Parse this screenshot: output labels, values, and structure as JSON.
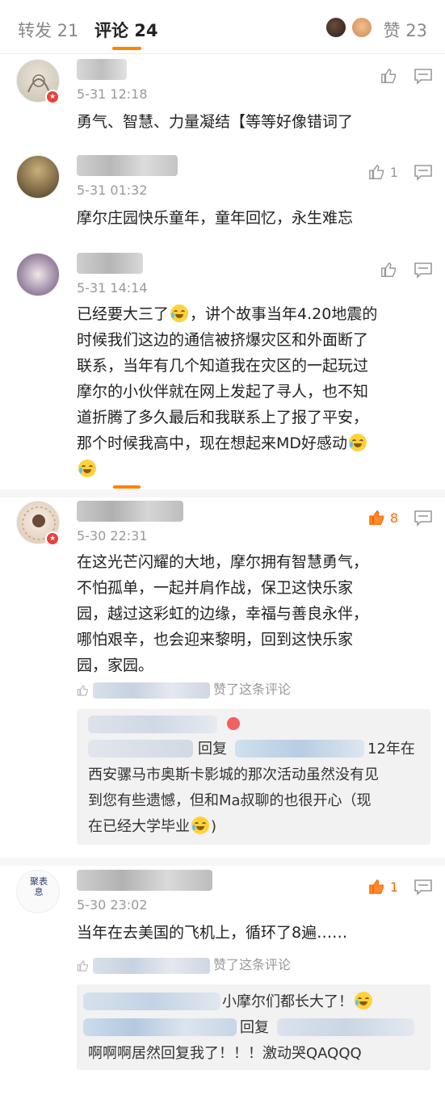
{
  "tabs": {
    "repost": "转发 21",
    "comment": "评论 24",
    "likes": "赞 23"
  },
  "comments": [
    {
      "time": "5-31 12:18",
      "likes": "",
      "text": "勇气、智慧、力量凝结【等等好像错词了"
    },
    {
      "time": "5-31 01:32",
      "likes": "1",
      "text": "摩尔庄园快乐童年，童年回忆，永生难忘"
    },
    {
      "time": "5-31 14:14",
      "likes": "",
      "lines": [
        "已经要大三了",
        "，讲个故事当年4.20地震的",
        "时候我们这边的通信被挤爆灾区和外面断了",
        "联系，当年有几个知道我在灾区的一起玩过",
        "摩尔的小伙伴就在网上发起了寻人，也不知",
        "道折腾了多久最后和我联系上了报了平安，",
        "那个时候我高中，现在想起来MD好感动"
      ]
    },
    {
      "time": "5-30 22:31",
      "likes": "8",
      "lines": [
        "在这光芒闪耀的大地，摩尔拥有智慧勇气，",
        "不怕孤单，一起并肩作战，保卫这快乐家",
        "园，越过这彩虹的边缘，幸福与善良永伴，",
        "哪怕艰辛，也会迎来黎明，回到这快乐家",
        "园，家园。"
      ],
      "liked_by": "赞了这条评论",
      "reply": {
        "prefix": "回复",
        "suffix": "12年在",
        "line2": "西安骡马市奥斯卡影城的那次活动虽然没有见",
        "line3": "到您有些遗憾，但和Ma叔聊的也很开心（现",
        "line4": "在已经大学毕业"
      }
    },
    {
      "time": "5-30 23:02",
      "likes": "1",
      "text": "当年在去美国的飞机上，循环了8遍……",
      "avatar_text": "聚表息",
      "liked_by": "赞了这条评论",
      "reply": {
        "line1": "小摩尔们都长大了！",
        "prefix": "回复",
        "line3": "啊啊啊居然回复我了！！！激动哭QAQQQ"
      }
    }
  ],
  "colors": {
    "accent": "#ff8200",
    "liked": "#ff6a00",
    "muted": "#999999"
  }
}
